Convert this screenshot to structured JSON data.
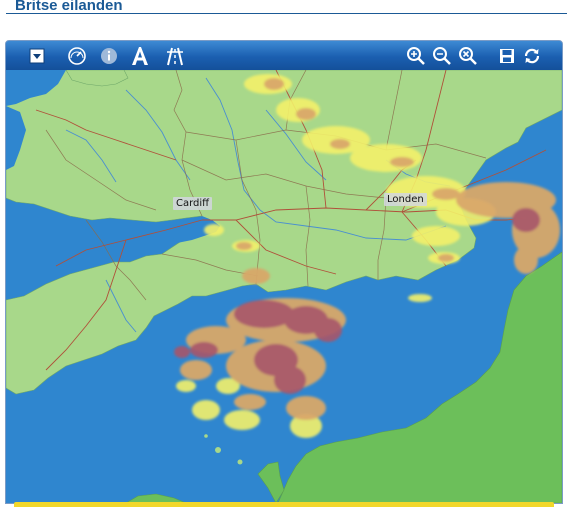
{
  "page": {
    "title": "Britse eilanden"
  },
  "toolbar": {
    "left_buttons": [
      {
        "icon": "dropdown-icon"
      },
      {
        "icon": "speedometer-icon"
      },
      {
        "icon": "info-icon"
      },
      {
        "icon": "text-labels-icon",
        "glyph": "A"
      },
      {
        "icon": "road-icon"
      }
    ],
    "right_buttons": [
      {
        "icon": "zoom-in-icon"
      },
      {
        "icon": "zoom-out-icon"
      },
      {
        "icon": "zoom-reset-icon"
      },
      {
        "icon": "save-icon"
      },
      {
        "icon": "refresh-icon"
      }
    ]
  },
  "map": {
    "cities": [
      {
        "name": "Cardiff"
      },
      {
        "name": "Londen"
      }
    ],
    "colors": {
      "sea": "#2f86cf",
      "land": "#a8d88a",
      "rain_light": "#f3f16a",
      "rain_moderate": "#d9a86a",
      "rain_heavy": "#a8566a"
    }
  }
}
